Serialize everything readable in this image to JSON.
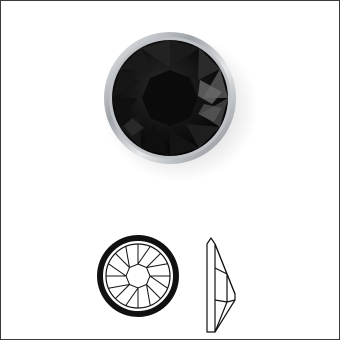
{
  "product": {
    "shape": "round-flatback-rhinestone",
    "stone_color": "#111111",
    "setting_color": "#c9ccd0",
    "background_color": "#ffffff",
    "frame_color": "#3a3a3a"
  },
  "views": {
    "photo": "stone-photo",
    "top_view": "stone-top-view-diagram",
    "side_view": "stone-side-view-diagram"
  }
}
